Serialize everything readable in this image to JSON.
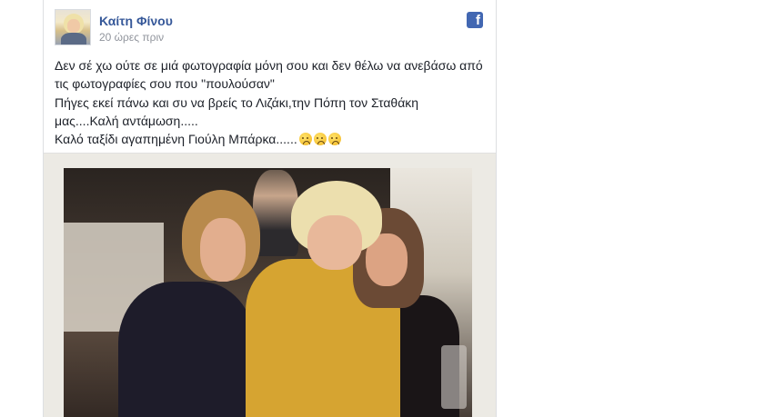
{
  "post": {
    "author": "Καίτη Φίνου",
    "timestamp": "20 ώρες πριν",
    "platform_icon": "facebook-icon",
    "text_lines": [
      "Δεν σέ χω ούτε σε μιά φωτογραφία μόνη σου και δεν θέλω να ανεβάσω από",
      "τις φωτογραφίες σου που \"πουλούσαν\"",
      "Πήγες εκεί πάνω και συ να βρείς το Λιζάκι,την Πόπη τον Σταθάκη",
      "μας....Καλή αντάμωση.....",
      "Καλό ταξίδι αγαπημένη Γιούλη Μπάρκα......"
    ],
    "emoji_count": 3,
    "emoji_name": "crying-face-icon",
    "photo_icon": "group-photo"
  },
  "colors": {
    "author_link": "#365899",
    "timestamp": "#90949c",
    "facebook_blue": "#4267b2",
    "text": "#1d2129"
  }
}
